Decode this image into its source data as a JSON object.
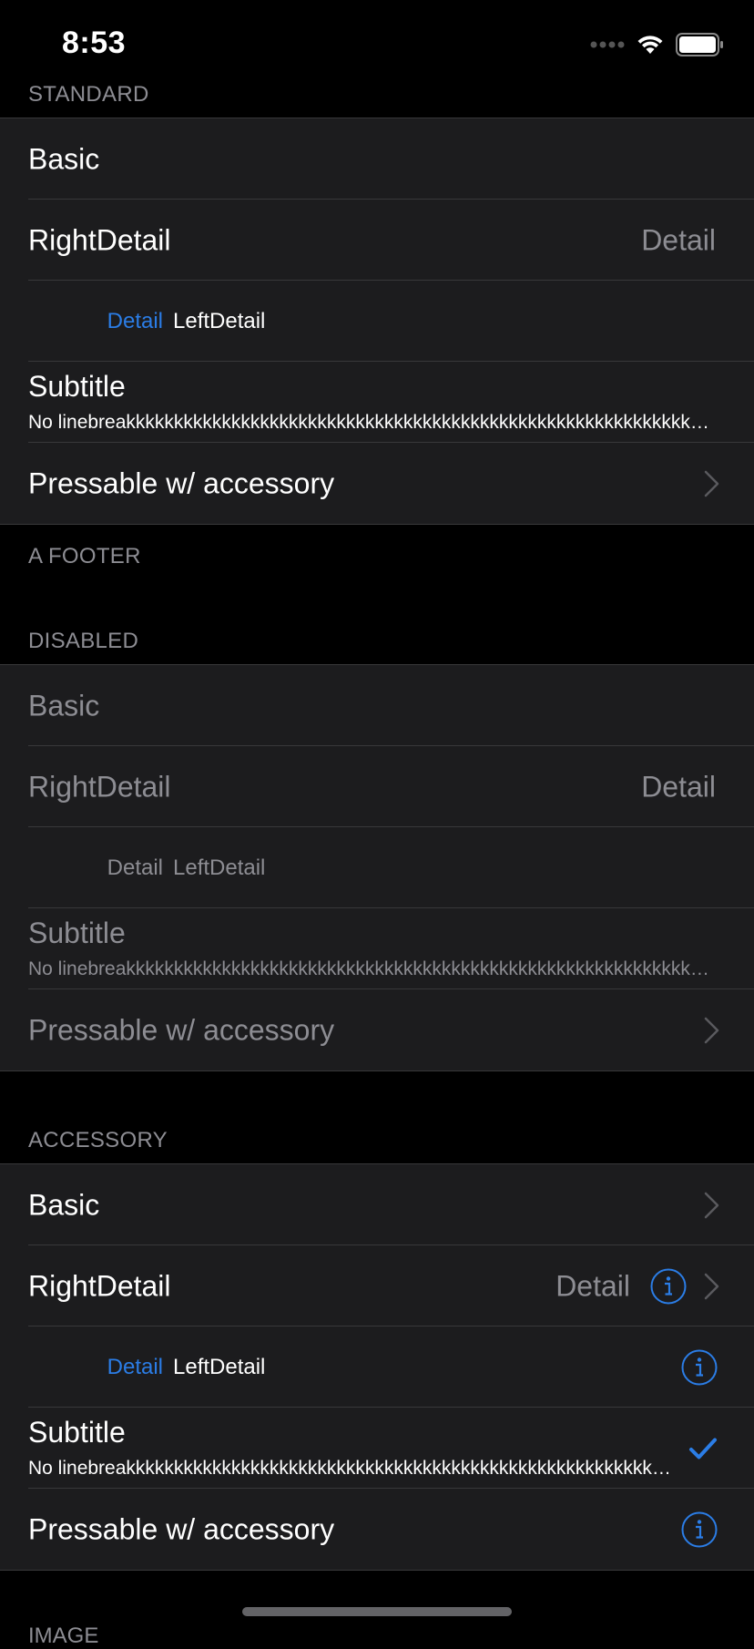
{
  "status_bar": {
    "time": "8:53"
  },
  "standard": {
    "header": "STANDARD",
    "basic": "Basic",
    "right_detail_title": "RightDetail",
    "right_detail_value": "Detail",
    "left_detail_label": "Detail",
    "left_detail_value": "LeftDetail",
    "subtitle_title": "Subtitle",
    "subtitle_text": "No linebreakkkkkkkkkkkkkkkkkkkkkkkkkkkkkkkkkkkkkkkkkkkkkkkkkkkkkkkkkkkkkkkkkkkkkkkkkkkk",
    "pressable": "Pressable w/ accessory",
    "footer": "A FOOTER"
  },
  "disabled": {
    "header": "DISABLED",
    "basic": "Basic",
    "right_detail_title": "RightDetail",
    "right_detail_value": "Detail",
    "left_detail_label": "Detail",
    "left_detail_value": "LeftDetail",
    "subtitle_title": "Subtitle",
    "subtitle_text": "No linebreakkkkkkkkkkkkkkkkkkkkkkkkkkkkkkkkkkkkkkkkkkkkkkkkkkkkkkkkkkkkkkkkkkkkkkkkkkkk",
    "pressable": "Pressable w/ accessory"
  },
  "accessory": {
    "header": "ACCESSORY",
    "basic": "Basic",
    "right_detail_title": "RightDetail",
    "right_detail_value": "Detail",
    "left_detail_label": "Detail",
    "left_detail_value": "LeftDetail",
    "subtitle_title": "Subtitle",
    "subtitle_text": "No linebreakkkkkkkkkkkkkkkkkkkkkkkkkkkkkkkkkkkkkkkkkkkkkkkkkkkkkkkkkkkkkkkkkkkkkkkkkkkk",
    "pressable": "Pressable w/ accessory"
  },
  "next_section_header": "IMAGE",
  "colors": {
    "background": "#000000",
    "cell": "#1c1c1e",
    "accent": "#2b7de6",
    "secondary_text": "#8d8d93"
  },
  "icons": [
    "wifi-icon",
    "battery-icon",
    "signal-icon",
    "chevron-right-icon",
    "info-icon",
    "checkmark-icon"
  ]
}
